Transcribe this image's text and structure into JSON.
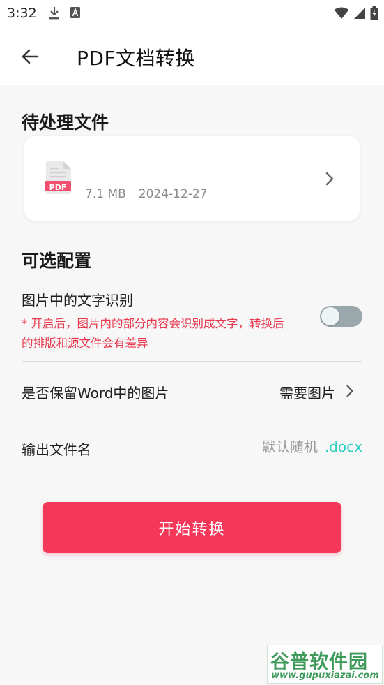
{
  "status_bar": {
    "time": "3:32"
  },
  "header": {
    "title": "PDF文档转换"
  },
  "files_section": {
    "title": "待处理文件",
    "file": {
      "type_badge": "PDF",
      "size": "7.1 MB",
      "date": "2024-12-27"
    }
  },
  "options_section": {
    "title": "可选配置",
    "ocr": {
      "label": "图片中的文字识别",
      "note": "* 开启后，图片内的部分内容会识别成文字，转换后的排版和源文件会有差异",
      "enabled": false
    },
    "keep_images": {
      "label": "是否保留Word中的图片",
      "value": "需要图片"
    },
    "output_name": {
      "label": "输出文件名",
      "placeholder": "默认随机",
      "extension": ".docx"
    }
  },
  "actions": {
    "start_label": "开始转换"
  },
  "watermark": {
    "title": "谷普软件园",
    "url": "www.gupuxiazai.com"
  },
  "colors": {
    "accent": "#f5375a",
    "note": "#e8384d",
    "extension": "#2bd0c0",
    "toggle_off": "#9aa8ac"
  }
}
